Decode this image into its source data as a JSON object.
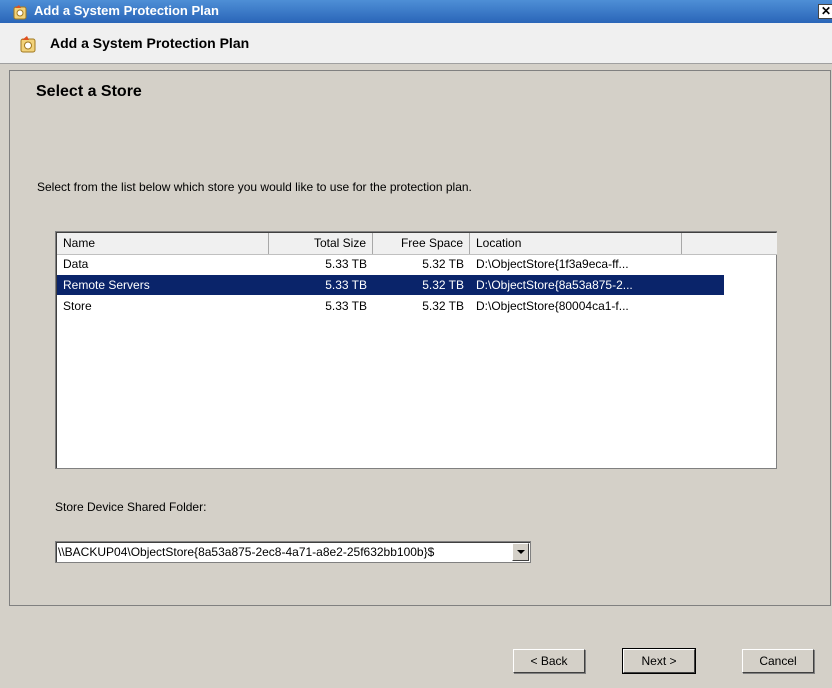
{
  "window": {
    "title": "Add a System Protection Plan",
    "close_label": "✕"
  },
  "header": {
    "title": "Add a System Protection Plan"
  },
  "panel": {
    "title": "Select a Store",
    "instructions": "Select from the list below which store you would like to use for the protection plan."
  },
  "list": {
    "columns": [
      "Name",
      "Total Size",
      "Free Space",
      "Location"
    ],
    "rows": [
      {
        "name": "Data",
        "total": "5.33 TB",
        "free": "5.32 TB",
        "location": "D:\\ObjectStore{1f3a9eca-ff...",
        "selected": false
      },
      {
        "name": "Remote Servers",
        "total": "5.33 TB",
        "free": "5.32 TB",
        "location": "D:\\ObjectStore{8a53a875-2...",
        "selected": true
      },
      {
        "name": "Store",
        "total": "5.33 TB",
        "free": "5.32 TB",
        "location": "D:\\ObjectStore{80004ca1-f...",
        "selected": false
      }
    ]
  },
  "store_folder": {
    "label": "Store Device Shared Folder:",
    "value": "\\\\BACKUP04\\ObjectStore{8a53a875-2ec8-4a71-a8e2-25f632bb100b}$"
  },
  "buttons": {
    "back": "< Back",
    "next": "Next >",
    "cancel": "Cancel"
  },
  "icons": {
    "app": "wizard-icon",
    "close": "close-icon",
    "dropdown": "chevron-down-icon"
  },
  "colors": {
    "selection": "#0a246a",
    "titlebar": "#2a65b8"
  }
}
